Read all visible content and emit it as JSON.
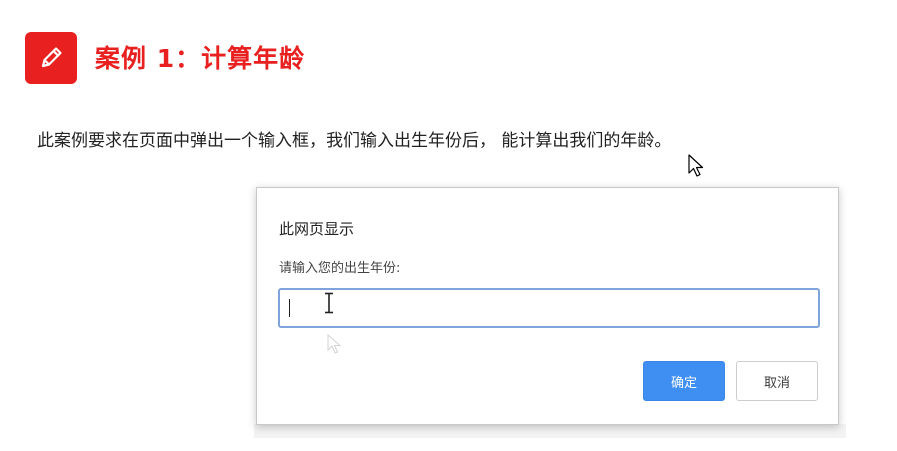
{
  "heading": {
    "icon": "pencil-icon",
    "text": "案例 1：计算年龄"
  },
  "description": "此案例要求在页面中弹出一个输入框，我们输入出生年份后， 能计算出我们的年龄。",
  "dialog": {
    "title": "此网页显示",
    "message": "请输入您的出生年份:",
    "input_value": "",
    "ok_label": "确定",
    "cancel_label": "取消"
  },
  "colors": {
    "accent_red": "#e8201f",
    "button_blue": "#3f8ef1",
    "input_border": "#7fa3dc"
  }
}
